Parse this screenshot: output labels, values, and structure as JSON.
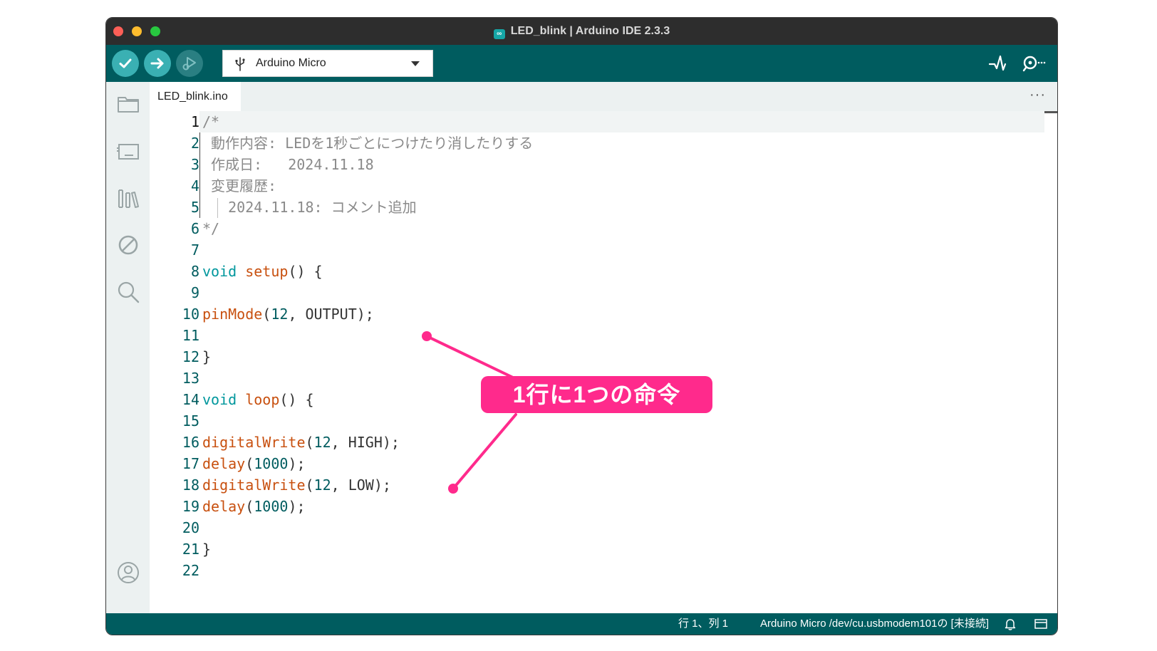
{
  "window": {
    "title": "LED_blink | Arduino IDE 2.3.3"
  },
  "toolbar": {
    "board_name": "Arduino Micro"
  },
  "tabs": [
    {
      "label": "LED_blink.ino"
    }
  ],
  "tab_overflow": "···",
  "editor": {
    "lines": [
      {
        "n": "1",
        "tokens": [
          {
            "t": "/*",
            "c": "comment"
          }
        ]
      },
      {
        "n": "2",
        "tokens": [
          {
            "t": " 動作内容: LEDを1秒ごとにつけたり消したりする",
            "c": "comment"
          }
        ]
      },
      {
        "n": "3",
        "tokens": [
          {
            "t": " 作成日:   2024.11.18",
            "c": "comment"
          }
        ]
      },
      {
        "n": "4",
        "tokens": [
          {
            "t": " 変更履歴:",
            "c": "comment"
          }
        ]
      },
      {
        "n": "5",
        "tokens": [
          {
            "t": "   2024.11.18: コメント追加",
            "c": "comment"
          }
        ]
      },
      {
        "n": "6",
        "tokens": [
          {
            "t": "*/",
            "c": "comment"
          }
        ]
      },
      {
        "n": "7",
        "tokens": []
      },
      {
        "n": "8",
        "tokens": [
          {
            "t": "void",
            "c": "type"
          },
          {
            "t": " ",
            "c": "plain"
          },
          {
            "t": "setup",
            "c": "fn"
          },
          {
            "t": "() {",
            "c": "plain"
          }
        ]
      },
      {
        "n": "9",
        "tokens": []
      },
      {
        "n": "10",
        "tokens": [
          {
            "t": "pinMode",
            "c": "fn"
          },
          {
            "t": "(",
            "c": "plain"
          },
          {
            "t": "12",
            "c": "num"
          },
          {
            "t": ", OUTPUT);",
            "c": "plain"
          }
        ]
      },
      {
        "n": "11",
        "tokens": []
      },
      {
        "n": "12",
        "tokens": [
          {
            "t": "}",
            "c": "plain"
          }
        ]
      },
      {
        "n": "13",
        "tokens": []
      },
      {
        "n": "14",
        "tokens": [
          {
            "t": "void",
            "c": "type"
          },
          {
            "t": " ",
            "c": "plain"
          },
          {
            "t": "loop",
            "c": "fn"
          },
          {
            "t": "() {",
            "c": "plain"
          }
        ]
      },
      {
        "n": "15",
        "tokens": []
      },
      {
        "n": "16",
        "tokens": [
          {
            "t": "digitalWrite",
            "c": "fn"
          },
          {
            "t": "(",
            "c": "plain"
          },
          {
            "t": "12",
            "c": "num"
          },
          {
            "t": ", HIGH);",
            "c": "plain"
          }
        ]
      },
      {
        "n": "17",
        "tokens": [
          {
            "t": "delay",
            "c": "fn"
          },
          {
            "t": "(",
            "c": "plain"
          },
          {
            "t": "1000",
            "c": "num"
          },
          {
            "t": ");",
            "c": "plain"
          }
        ]
      },
      {
        "n": "18",
        "tokens": [
          {
            "t": "digitalWrite",
            "c": "fn"
          },
          {
            "t": "(",
            "c": "plain"
          },
          {
            "t": "12",
            "c": "num"
          },
          {
            "t": ", LOW);",
            "c": "plain"
          }
        ]
      },
      {
        "n": "19",
        "tokens": [
          {
            "t": "delay",
            "c": "fn"
          },
          {
            "t": "(",
            "c": "plain"
          },
          {
            "t": "1000",
            "c": "num"
          },
          {
            "t": ");",
            "c": "plain"
          }
        ]
      },
      {
        "n": "20",
        "tokens": []
      },
      {
        "n": "21",
        "tokens": [
          {
            "t": "}",
            "c": "plain"
          }
        ]
      },
      {
        "n": "22",
        "tokens": []
      }
    ]
  },
  "status": {
    "cursor": "行 1、列 1",
    "board_port": "Arduino Micro /dev/cu.usbmodem101の [未接続]"
  },
  "annotation": {
    "label": "1行に1つの命令",
    "color": "#ff2a8c"
  },
  "colors": {
    "toolbar_bg": "#005c5f",
    "button_bg": "#3ab0b3",
    "comment": "#8a8a8a",
    "keyword_type": "#00979d",
    "function": "#c8500f"
  },
  "icons": {
    "verify": "check-icon",
    "upload": "arrow-right-icon",
    "debug": "debug-icon",
    "board": "usb-icon",
    "serial_plotter": "pulse-icon",
    "serial_monitor": "serial-monitor-icon",
    "sidebar": [
      "folder-icon",
      "board-icon",
      "library-icon",
      "debug-disabled-icon",
      "search-icon",
      "account-icon"
    ],
    "status": [
      "bell-icon",
      "panel-icon"
    ]
  }
}
